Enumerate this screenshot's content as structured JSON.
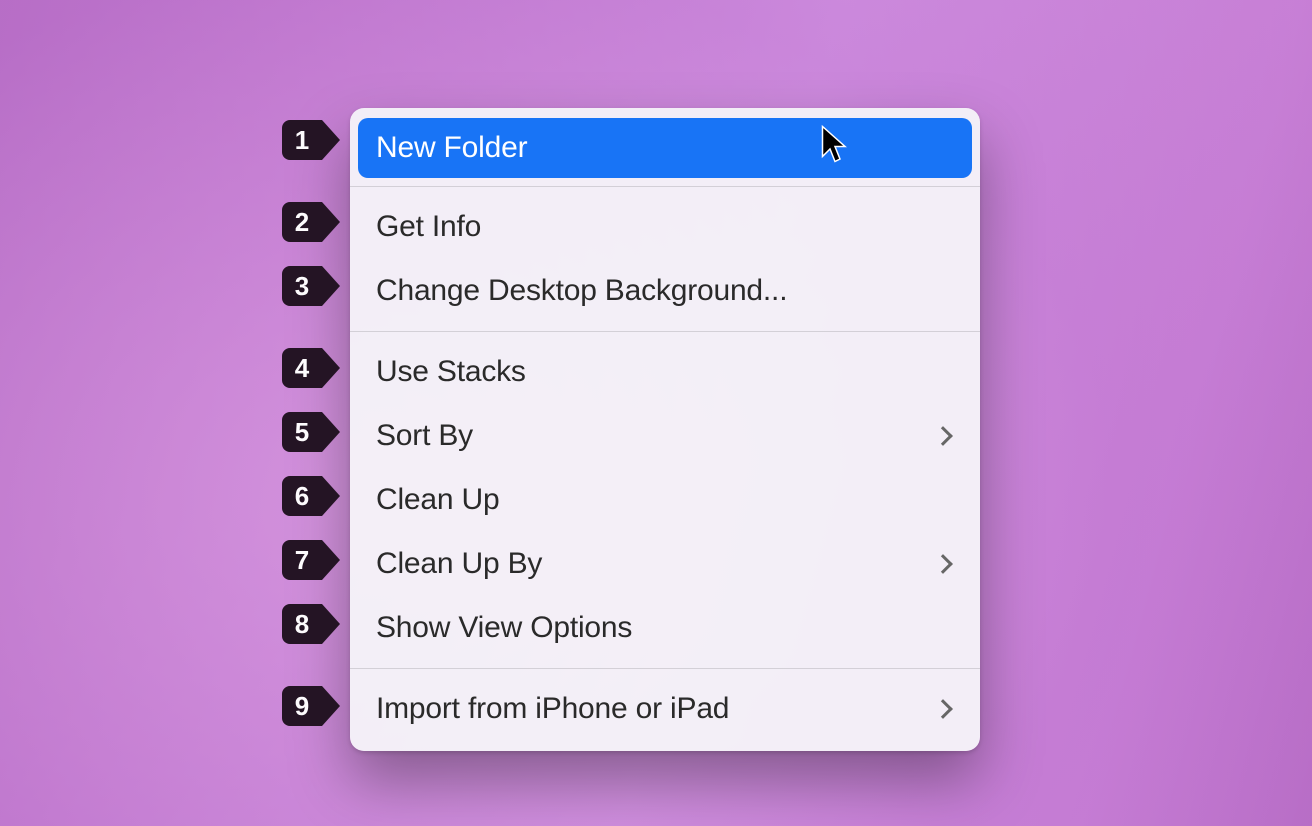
{
  "context_menu": {
    "groups": [
      {
        "items": [
          {
            "id": "new-folder",
            "label": "New Folder",
            "submenu": false,
            "highlighted": true
          }
        ]
      },
      {
        "items": [
          {
            "id": "get-info",
            "label": "Get Info",
            "submenu": false,
            "highlighted": false
          },
          {
            "id": "change-bg",
            "label": "Change Desktop Background...",
            "submenu": false,
            "highlighted": false
          }
        ]
      },
      {
        "items": [
          {
            "id": "use-stacks",
            "label": "Use Stacks",
            "submenu": false,
            "highlighted": false
          },
          {
            "id": "sort-by",
            "label": "Sort By",
            "submenu": true,
            "highlighted": false
          },
          {
            "id": "clean-up",
            "label": "Clean Up",
            "submenu": false,
            "highlighted": false
          },
          {
            "id": "clean-up-by",
            "label": "Clean Up By",
            "submenu": true,
            "highlighted": false
          },
          {
            "id": "show-view-options",
            "label": "Show View Options",
            "submenu": false,
            "highlighted": false
          }
        ]
      },
      {
        "items": [
          {
            "id": "import-device",
            "label": "Import from iPhone or iPad",
            "submenu": true,
            "highlighted": false
          }
        ]
      }
    ]
  },
  "badges": [
    {
      "number": "1"
    },
    {
      "number": "2"
    },
    {
      "number": "3"
    },
    {
      "number": "4"
    },
    {
      "number": "5"
    },
    {
      "number": "6"
    },
    {
      "number": "7"
    },
    {
      "number": "8"
    },
    {
      "number": "9"
    }
  ]
}
